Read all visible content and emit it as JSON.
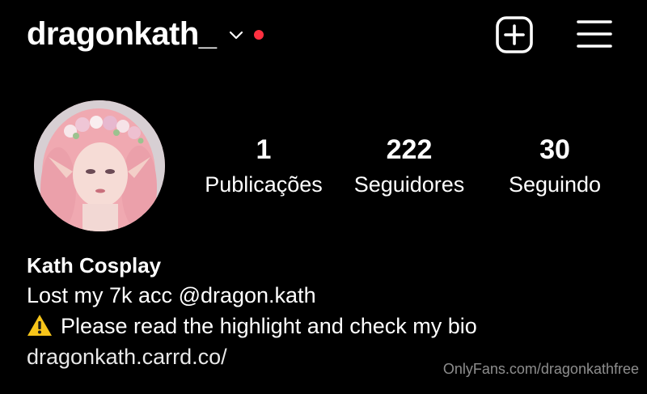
{
  "header": {
    "username": "dragonkath_",
    "chevron_icon": "chevron-down-icon",
    "notification_color": "#ff3040",
    "new_post_icon": "plus-square-icon",
    "menu_icon": "hamburger-menu-icon"
  },
  "profile": {
    "avatar_icon": "profile-photo",
    "stats": [
      {
        "value": "1",
        "label": "Publicações"
      },
      {
        "value": "222",
        "label": "Seguidores"
      },
      {
        "value": "30",
        "label": "Seguindo"
      }
    ]
  },
  "bio": {
    "name": "Kath Cosplay",
    "line1": "Lost my 7k acc @dragon.kath",
    "line2": "Please read the highlight and check my bio",
    "line2_icon": "warning-icon",
    "link": "dragonkath.carrd.co/"
  },
  "watermark": "OnlyFans.com/dragonkathfree"
}
